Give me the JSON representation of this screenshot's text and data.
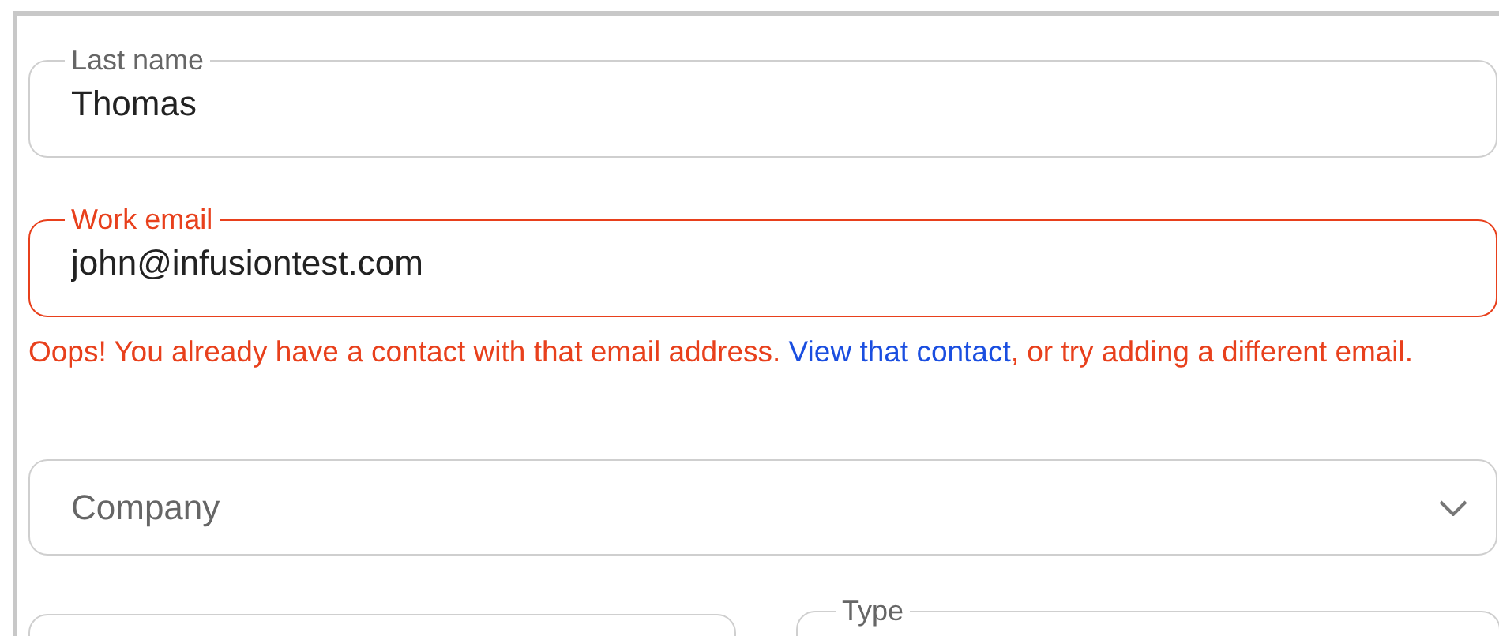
{
  "fields": [
    {
      "kind": "text",
      "label": "Last name",
      "value": "Thomas",
      "error": false
    },
    {
      "kind": "text",
      "label": "Work email",
      "value": "john@infusiontest.com",
      "error": true,
      "message": {
        "before": "Oops! You already have a contact with that email address. ",
        "link": "View that contact",
        "after": ", or try adding a different email."
      }
    },
    {
      "kind": "select",
      "placeholder": "Company"
    }
  ],
  "bottom_row": [
    {
      "kind": "field"
    },
    {
      "kind": "field",
      "label": "Type"
    }
  ]
}
